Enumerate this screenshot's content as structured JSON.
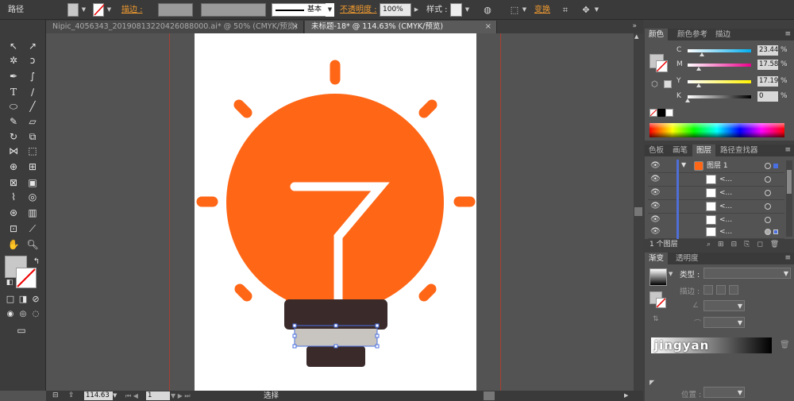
{
  "control_bar": {
    "object_type": "路径",
    "stroke_label": "描边 :",
    "opacity_label": "不透明度 :",
    "opacity_value": "100%",
    "stroke_profile": "基本",
    "style_label": "样式 :",
    "transform_label": "变换"
  },
  "tabs": [
    {
      "label": "Nipic_4056343_20190813220426088000.ai* @ 50% (CMYK/预览)",
      "active": false
    },
    {
      "label": "未标题-18* @ 114.63% (CMYK/预览)",
      "active": true
    }
  ],
  "close_glyph": "×",
  "status_bar": {
    "zoom": "114.63",
    "artboard_number": "1",
    "tool_name": "选择"
  },
  "color_panel": {
    "tabs": [
      "颜色",
      "颜色参考",
      "描边"
    ],
    "sliders": [
      {
        "label": "C",
        "value": "23.44",
        "knob": 0.23,
        "gradient": "linear-gradient(90deg,#fff,#00aeef)"
      },
      {
        "label": "M",
        "value": "17.58",
        "knob": 0.18,
        "gradient": "linear-gradient(90deg,#fff,#ec008c)"
      },
      {
        "label": "Y",
        "value": "17.19",
        "knob": 0.17,
        "gradient": "linear-gradient(90deg,#fff,#fff200)"
      },
      {
        "label": "K",
        "value": "0",
        "knob": 0.0,
        "gradient": "linear-gradient(90deg,#fff,#000)"
      }
    ],
    "unit": "%"
  },
  "layers_panel": {
    "tabs": [
      "色板",
      "画笔",
      "图层",
      "路径查找器"
    ],
    "top_layer": "图层 1",
    "sublayers": [
      "<...",
      "<...",
      "<...",
      "<...",
      "<..."
    ],
    "footer": "1 个图层"
  },
  "gradient_panel": {
    "tabs": [
      "渐变",
      "透明度"
    ],
    "type_label": "类型 :",
    "stroke_label": "描边 :",
    "position_label": "位置 :"
  },
  "watermark": "jingyan",
  "colors": {
    "accent_orange": "#ff6616",
    "base_dark": "#3a2a2a",
    "base_gray": "#c8c4c0",
    "selection_blue": "#4a6fe0",
    "fill_swatch": "#c8c8c8"
  }
}
